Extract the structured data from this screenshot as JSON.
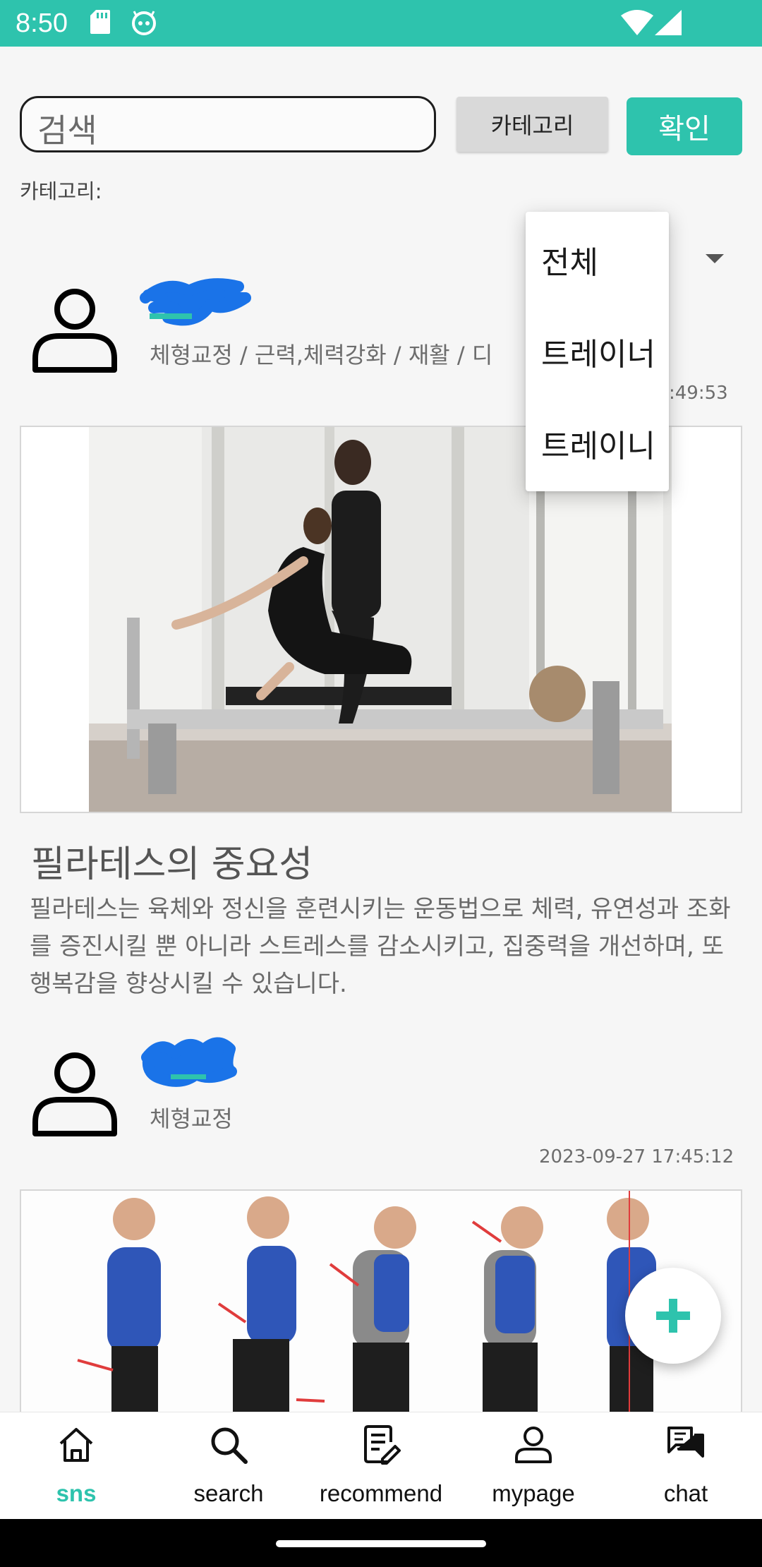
{
  "status_bar": {
    "time": "8:50",
    "icons": [
      "sd-card-icon",
      "app-notification-icon",
      "wifi-icon",
      "cell-signal-icon"
    ]
  },
  "search": {
    "placeholder": "검색",
    "category_button": "카테고리",
    "confirm_button": "확인",
    "category_label": "카테고리:"
  },
  "dropdown": {
    "options": [
      "전체",
      "트레이너",
      "트레이니"
    ]
  },
  "posts": [
    {
      "tags": "체형교정 / 근력,체력강화 / 재활 / 디",
      "time": ":49:53",
      "title": "필라테스의 중요성",
      "body": "필라테스는 육체와 정신을 훈련시키는 운동법으로 체력, 유연성과 조화를 증진시킬 뿐 아니라 스트레스를 감소시키고, 집중력을 개선하며, 또 행복감을 향상시킬 수 있습니다."
    },
    {
      "tags": "체형교정",
      "time": "2023-09-27 17:45:12"
    }
  ],
  "fab": {
    "icon": "plus-icon"
  },
  "bottom_nav": {
    "items": [
      {
        "label": "sns",
        "icon": "home-icon",
        "active": true
      },
      {
        "label": "search",
        "icon": "search-icon",
        "active": false
      },
      {
        "label": "recommend",
        "icon": "document-edit-icon",
        "active": false
      },
      {
        "label": "mypage",
        "icon": "person-icon",
        "active": false
      },
      {
        "label": "chat",
        "icon": "chat-icon",
        "active": false
      }
    ]
  },
  "colors": {
    "accent": "#2ec3ad",
    "scribble": "#1a73e8"
  }
}
